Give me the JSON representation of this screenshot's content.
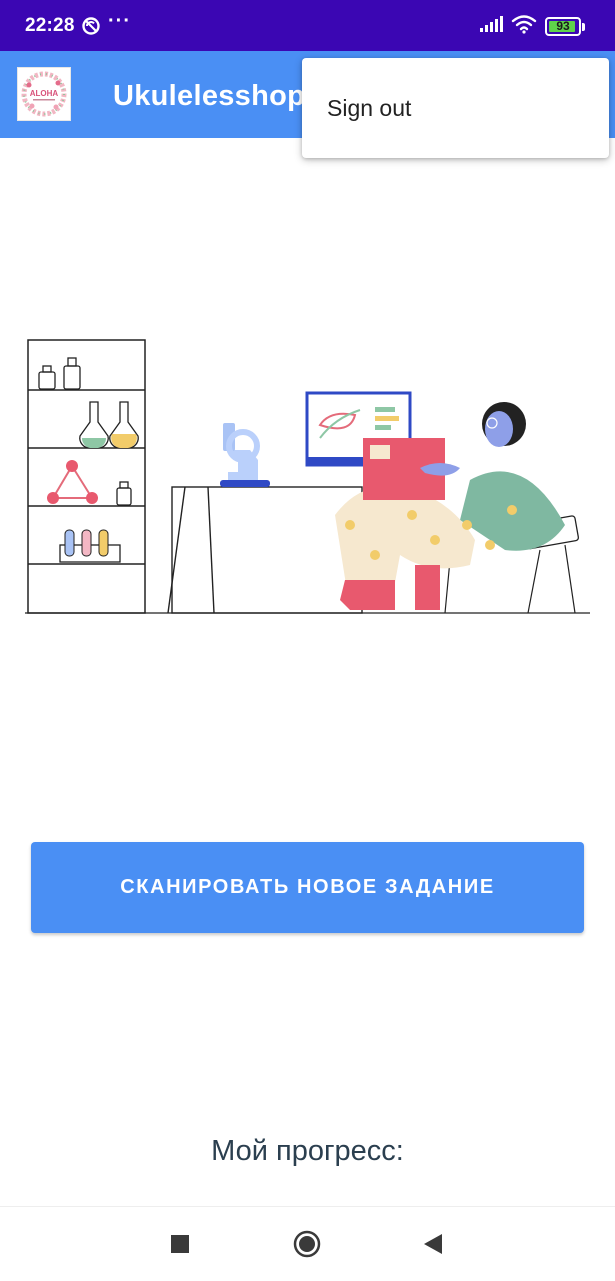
{
  "status_bar": {
    "time": "22:28",
    "overflow": "···",
    "battery_level": "93",
    "battery_fraction": 0.93,
    "icons": [
      "sync-off-icon",
      "signal-icon",
      "wifi-icon",
      "battery-icon"
    ]
  },
  "app_bar": {
    "title": "Ukulelesshop",
    "logo_text": "ALOHA",
    "brand_color": "#4a8ff4"
  },
  "menu": {
    "items": [
      {
        "label": "Sign out"
      }
    ]
  },
  "main": {
    "scan_button_label": "СКАНИРОВАТЬ НОВОЕ ЗАДАНИЕ",
    "progress_label": "Мой прогресс:"
  },
  "nav": {
    "icons": [
      "recents-square-icon",
      "home-circle-icon",
      "back-triangle-icon"
    ]
  }
}
